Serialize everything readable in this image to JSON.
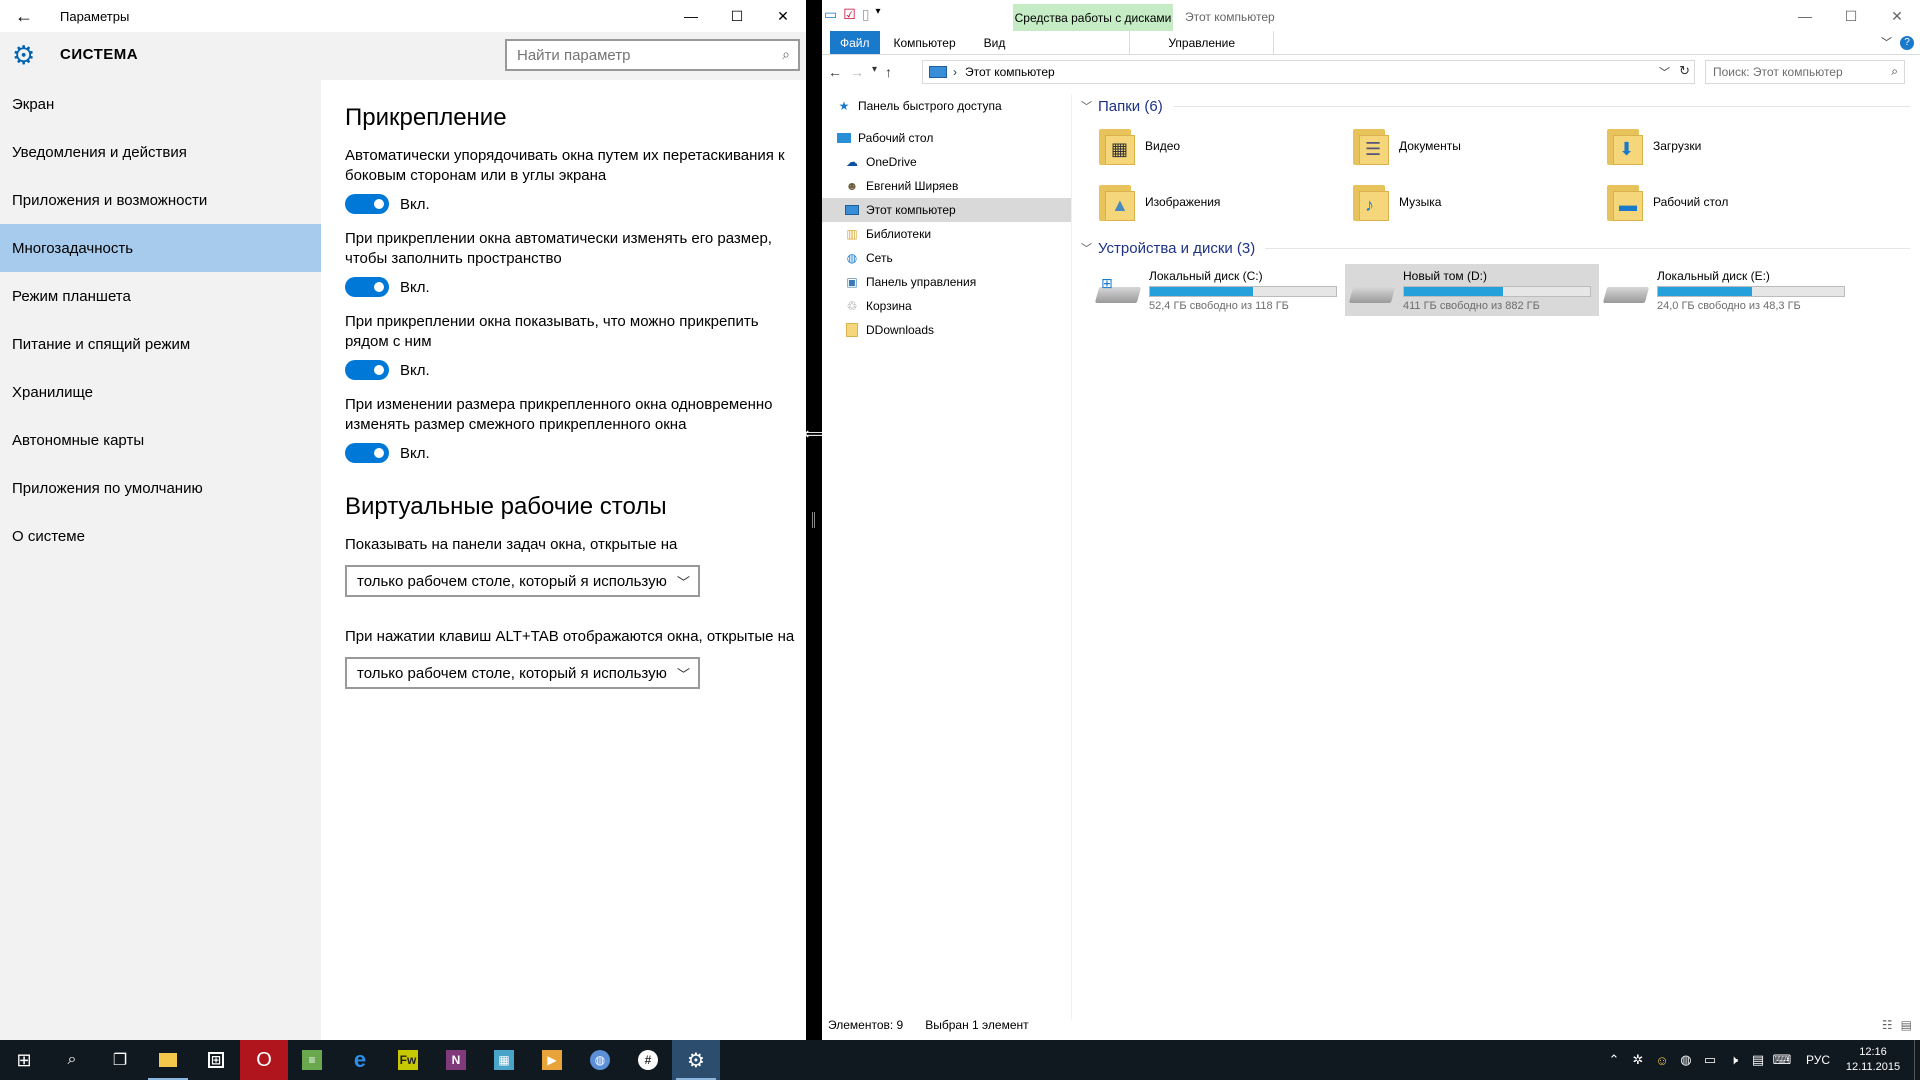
{
  "settings": {
    "window_title": "Параметры",
    "section_title": "СИСТЕМА",
    "search_placeholder": "Найти параметр",
    "menu": [
      {
        "label": "Экран"
      },
      {
        "label": "Уведомления и действия"
      },
      {
        "label": "Приложения и возможности"
      },
      {
        "label": "Многозадачность",
        "active": true
      },
      {
        "label": "Режим планшета"
      },
      {
        "label": "Питание и спящий режим"
      },
      {
        "label": "Хранилище"
      },
      {
        "label": "Автономные карты"
      },
      {
        "label": "Приложения по умолчанию"
      },
      {
        "label": "О системе"
      }
    ],
    "snap": {
      "title": "Прикрепление",
      "options": [
        {
          "text": "Автоматически упорядочивать окна путем их перетаскивания к боковым сторонам или в углы экрана",
          "state": "Вкл."
        },
        {
          "text": "При прикреплении окна автоматически изменять его размер, чтобы заполнить пространство",
          "state": "Вкл."
        },
        {
          "text": "При прикреплении окна показывать, что можно прикрепить рядом с ним",
          "state": "Вкл."
        },
        {
          "text": "При изменении размера прикрепленного окна одновременно изменять размер смежного прикрепленного окна",
          "state": "Вкл."
        }
      ]
    },
    "virtual": {
      "title": "Виртуальные рабочие столы",
      "taskbar_label": "Показывать на панели задач окна, открытые на",
      "taskbar_value": "только рабочем столе, который я использую",
      "alttab_label": "При нажатии клавиш ALT+TAB отображаются окна, открытые на",
      "alttab_value": "только рабочем столе, который я использую"
    }
  },
  "explorer": {
    "context_tab": "Средства работы с дисками",
    "window_title": "Этот компьютер",
    "ribbon": {
      "file": "Файл",
      "computer": "Компьютер",
      "view": "Вид",
      "manage": "Управление"
    },
    "address": "Этот компьютер",
    "search_placeholder": "Поиск: Этот компьютер",
    "nav": [
      {
        "label": "Панель быстрого доступа",
        "icon": "star-icon"
      },
      {
        "label": "Рабочий стол",
        "icon": "desktop-icon"
      },
      {
        "label": "OneDrive",
        "icon": "cloud-icon"
      },
      {
        "label": "Евгений Ширяев",
        "icon": "user-icon"
      },
      {
        "label": "Этот компьютер",
        "icon": "computer-icon",
        "selected": true
      },
      {
        "label": "Библиотеки",
        "icon": "library-icon"
      },
      {
        "label": "Сеть",
        "icon": "network-icon"
      },
      {
        "label": "Панель управления",
        "icon": "control-panel-icon"
      },
      {
        "label": "Корзина",
        "icon": "recycle-bin-icon"
      },
      {
        "label": "DDownloads",
        "icon": "folder-icon"
      }
    ],
    "folders_group": "Папки (6)",
    "folders": [
      {
        "label": "Видео",
        "icon": "video-folder-icon"
      },
      {
        "label": "Документы",
        "icon": "documents-folder-icon"
      },
      {
        "label": "Загрузки",
        "icon": "downloads-folder-icon"
      },
      {
        "label": "Изображения",
        "icon": "pictures-folder-icon"
      },
      {
        "label": "Музыка",
        "icon": "music-folder-icon"
      },
      {
        "label": "Рабочий стол",
        "icon": "desktop-folder-icon"
      }
    ],
    "drives_group": "Устройства и диски (3)",
    "drives": [
      {
        "label": "Локальный диск (C:)",
        "free": "52,4 ГБ свободно из 118 ГБ",
        "used_fraction": 0.556
      },
      {
        "label": "Новый том (D:)",
        "free": "411 ГБ свободно из 882 ГБ",
        "used_fraction": 0.534,
        "selected": true
      },
      {
        "label": "Локальный диск (E:)",
        "free": "24,0 ГБ свободно из 48,3 ГБ",
        "used_fraction": 0.503
      }
    ],
    "status_items": "Элементов: 9",
    "status_selected": "Выбран 1 элемент"
  },
  "taskbar": {
    "lang": "РУС",
    "time": "12:16",
    "date": "12.11.2015",
    "colors": {
      "background": "#101820",
      "accent": "#0078d7"
    }
  }
}
